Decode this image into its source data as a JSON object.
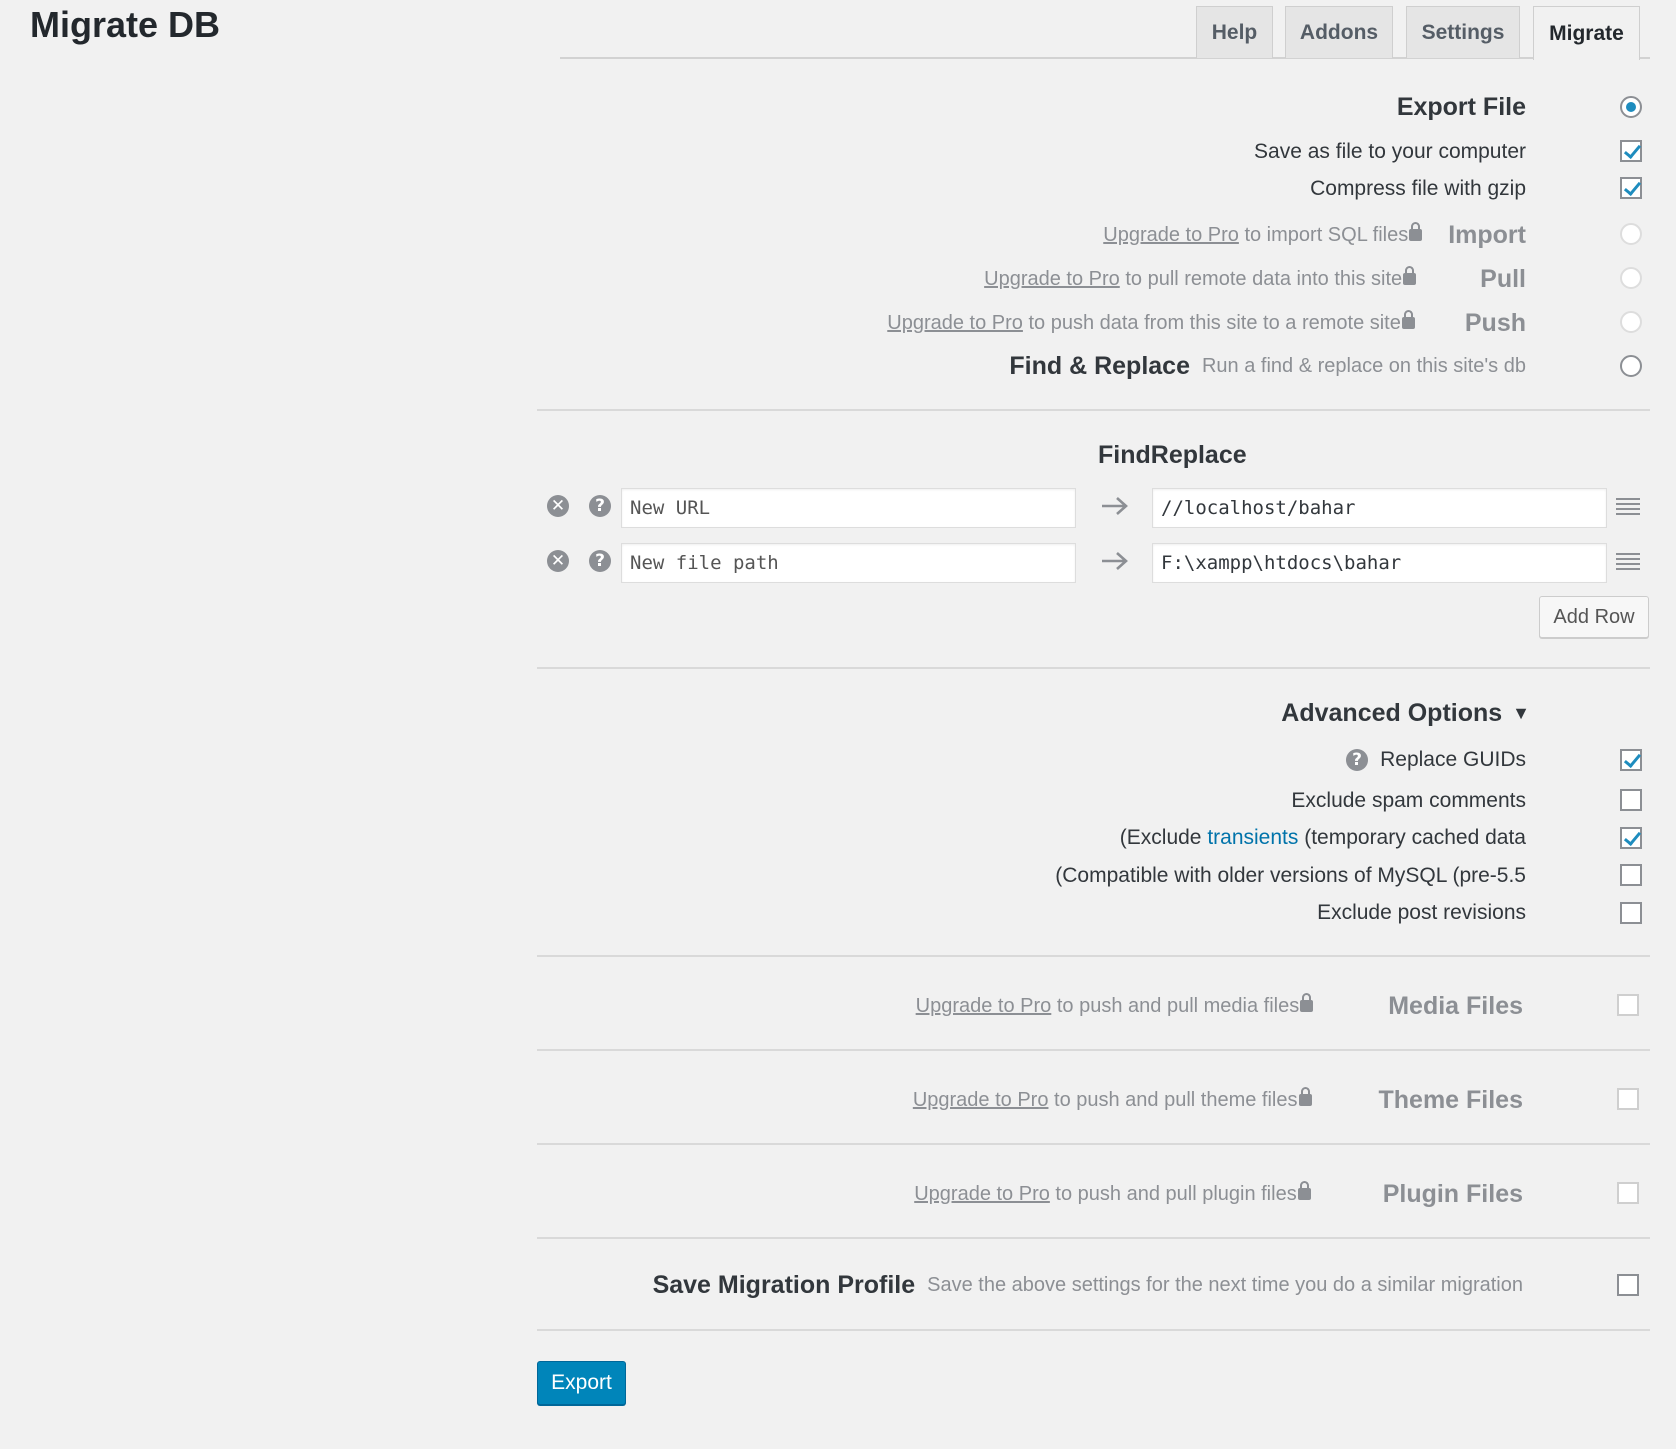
{
  "page_title": "Migrate DB",
  "tabs": [
    {
      "label": "Help"
    },
    {
      "label": "Addons"
    },
    {
      "label": "Settings"
    },
    {
      "label": "Migrate",
      "active": true
    }
  ],
  "actions": {
    "export": {
      "label": "Export File",
      "selected": true
    },
    "save_as_file": {
      "label": "Save as file to your computer",
      "checked": true
    },
    "compress_gzip": {
      "label": "Compress file with gzip",
      "checked": true
    },
    "import": {
      "link": "Upgrade to Pro",
      "desc": " to import SQL files",
      "label": "Import"
    },
    "pull": {
      "link": "Upgrade to Pro",
      "desc": " to pull remote data into this site",
      "label": "Pull"
    },
    "push": {
      "link": "Upgrade to Pro",
      "desc": " to push data from this site to a remote site",
      "label": "Push"
    },
    "find_replace": {
      "label": "Find & Replace",
      "desc": "Run a find & replace on this site's db"
    }
  },
  "find_replace": {
    "title": "FindReplace",
    "rows": [
      {
        "find_placeholder": "New URL",
        "replace_value": "//localhost/bahar"
      },
      {
        "find_placeholder": "New file path",
        "replace_value": "F:\\xampp\\htdocs\\bahar"
      }
    ],
    "add_row_label": "Add Row"
  },
  "advanced": {
    "title": "Advanced Options",
    "toggle_glyph": "▼",
    "replace_guids": {
      "label": "Replace GUIDs",
      "checked": true
    },
    "exclude_spam": {
      "label": "Exclude spam comments",
      "checked": false
    },
    "exclude_transients": {
      "prefix": "(Exclude ",
      "link": "transients",
      "suffix": " (temporary cached data",
      "checked": true
    },
    "compat_mysql": {
      "label": "(Compatible with older versions of MySQL (pre-5.5",
      "checked": false
    },
    "exclude_revisions": {
      "label": "Exclude post revisions",
      "checked": false
    }
  },
  "files": {
    "media": {
      "link": "Upgrade to Pro",
      "desc": " to push and pull media files",
      "label": "Media Files"
    },
    "theme": {
      "link": "Upgrade to Pro",
      "desc": " to push and pull theme files",
      "label": "Theme Files"
    },
    "plugin": {
      "link": "Upgrade to Pro",
      "desc": " to push and pull plugin files",
      "label": "Plugin Files"
    }
  },
  "save_profile": {
    "label": "Save Migration Profile",
    "desc": "Save the above settings for the next time you do a similar migration",
    "checked": false
  },
  "export_button": "Export",
  "colors": {
    "accent": "#1e8cbe",
    "primary_button": "#0085ba",
    "muted_text": "#8c8f94"
  },
  "icons": [
    "remove-row-icon",
    "help-icon",
    "arrow-right-icon",
    "drag-handle-icon",
    "lock-icon",
    "dropdown-triangle-icon"
  ]
}
